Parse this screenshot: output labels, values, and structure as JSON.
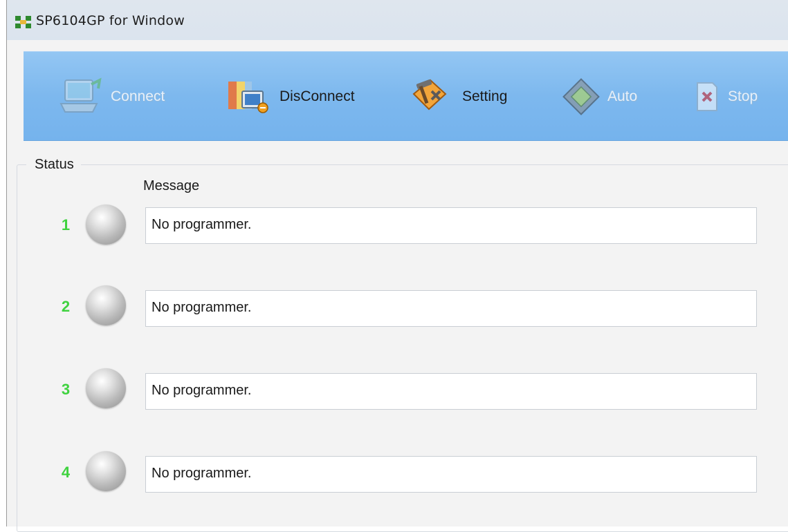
{
  "window": {
    "title": "SP6104GP for Window"
  },
  "toolbar": {
    "items": [
      {
        "label": "Connect",
        "icon": "computer-connect-icon",
        "enabled": false
      },
      {
        "label": "DisConnect",
        "icon": "disconnect-icon",
        "enabled": true
      },
      {
        "label": "Setting",
        "icon": "tools-setting-icon",
        "enabled": true
      },
      {
        "label": "Auto",
        "icon": "chip-auto-icon",
        "enabled": false
      },
      {
        "label": "Stop",
        "icon": "stop-x-icon",
        "enabled": false
      }
    ]
  },
  "status": {
    "group_label": "Status",
    "message_header": "Message",
    "rows": [
      {
        "number": "1",
        "message": "No programmer.",
        "led_state": "off"
      },
      {
        "number": "2",
        "message": "No programmer.",
        "led_state": "off"
      },
      {
        "number": "3",
        "message": "No programmer.",
        "led_state": "off"
      },
      {
        "number": "4",
        "message": "No programmer.",
        "led_state": "off"
      }
    ]
  },
  "colors": {
    "toolbar_background": "#7db8ee",
    "row_number": "#3fd23f",
    "led_off": "#b8b8b8"
  }
}
